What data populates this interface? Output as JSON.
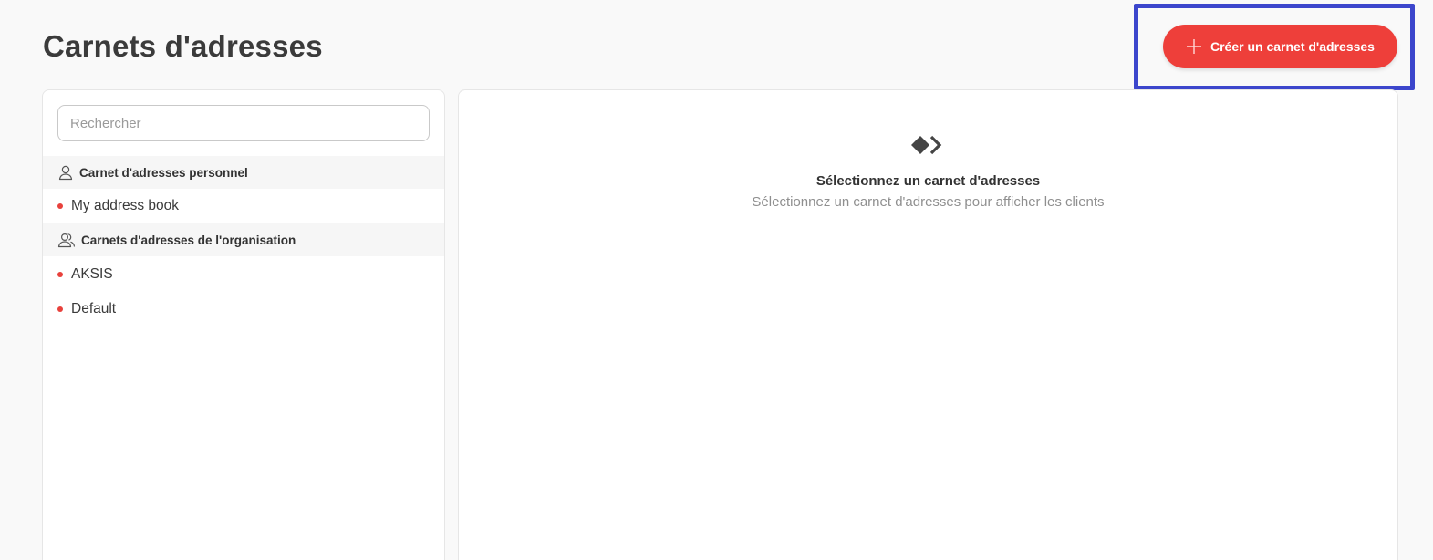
{
  "header": {
    "title": "Carnets d'adresses",
    "create_button_label": "Créer un carnet d'adresses"
  },
  "search": {
    "placeholder": "Rechercher"
  },
  "sections": {
    "personal": {
      "label": "Carnet d'adresses personnel",
      "icon": "user-icon",
      "items": [
        "My address book"
      ]
    },
    "organization": {
      "label": "Carnets d'adresses de l'organisation",
      "icon": "users-icon",
      "items": [
        "AKSIS",
        "Default"
      ]
    }
  },
  "empty_state": {
    "icon": "select-pointer-icon",
    "title": "Sélectionnez un carnet d'adresses",
    "subtitle": "Sélectionnez un carnet d'adresses pour afficher les clients"
  },
  "colors": {
    "accent": "#ee3f3a",
    "annotation": "#3c46cc",
    "background": "#f9f9f9"
  }
}
